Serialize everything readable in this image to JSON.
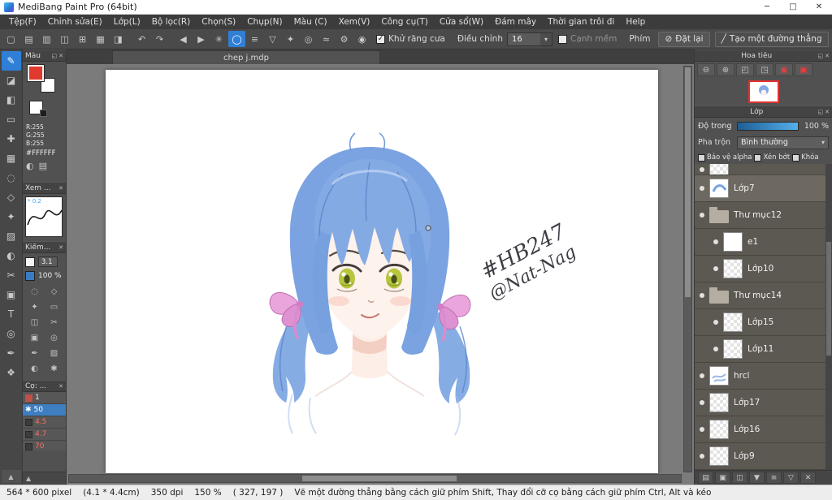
{
  "window": {
    "title": "MediBang Paint Pro (64bit)",
    "minimize": "─",
    "maximize": "□",
    "close": "✕"
  },
  "menu": {
    "items": [
      "Tệp(F)",
      "Chỉnh sửa(E)",
      "Lớp(L)",
      "Bộ lọc(R)",
      "Chọn(S)",
      "Chụp(N)",
      "Màu (C)",
      "Xem(V)",
      "Công cụ(T)",
      "Cửa sổ(W)",
      "Đám mây",
      "Thời gian trôi đi",
      "Help"
    ]
  },
  "toolbar": {
    "icons": [
      "▢",
      "▤",
      "▥",
      "◫",
      "⊞",
      "▦",
      "◨",
      "↶",
      "↷",
      "◀",
      "▶",
      "✳",
      "◯",
      "≡",
      "▽",
      "✦",
      "◎",
      "≈",
      "⚙",
      "◉"
    ],
    "check_mark": "✓",
    "antialias_label": "Khử răng cưa",
    "adjust_label": "Điều chỉnh",
    "adjust_value": "16",
    "dropdown_arrow": "▾",
    "soft_edge_label": "Cạnh mềm",
    "key_label": "Phím",
    "reset_icon": "⊘",
    "reset_label": "Đặt lại",
    "line_icon": "╱",
    "line_label": "Tạo một đường thẳng"
  },
  "tools": {
    "icons": [
      "✎",
      "◪",
      "◧",
      "▭",
      "✚",
      "▦",
      "◌",
      "◇",
      "✦",
      "▨",
      "◐",
      "✂",
      "▣",
      "T",
      "◎",
      "✒",
      "❖"
    ]
  },
  "panel_chrome": {
    "float_icon": "◱",
    "close_icon": "✕",
    "collapse_icon": "▲"
  },
  "color_panel": {
    "title": "Màu",
    "r": "R:255",
    "g": "G:255",
    "b": "B:255",
    "hex": "#FFFFFF",
    "icons": [
      "◐",
      "▤"
    ]
  },
  "preview_panel": {
    "title": "Xem ...",
    "value": "* 0.2"
  },
  "control_panel": {
    "title": "Kiểm...",
    "size_value": "3.1",
    "opacity_value": "100 %",
    "grid_icons": [
      "◌",
      "◇",
      "✦",
      "▭",
      "◫",
      "✂",
      "▣",
      "◎",
      "✒",
      "▨",
      "◐",
      "✱"
    ]
  },
  "brush_panel": {
    "title": "Cọ: ...",
    "star_icon": "✱",
    "items": [
      {
        "label": "1"
      },
      {
        "label": "50"
      },
      {
        "label": "4.5"
      },
      {
        "label": "4.7"
      },
      {
        "label": "70"
      }
    ]
  },
  "canvas": {
    "tab": "chep j.mdp",
    "signature_line1": "#HB247",
    "signature_line2": "@Nat-Nag"
  },
  "navigator": {
    "title": "Hoa tiêu",
    "icons": [
      "⊖",
      "⊕",
      "◰",
      "◳",
      "▣",
      "▣"
    ]
  },
  "layers": {
    "title": "Lớp",
    "opacity_label": "Độ trong",
    "opacity_value": "100 %",
    "blend_label": "Pha trộn",
    "blend_value": "Bình thường",
    "dropdown_arrow": "▾",
    "checkboxes": [
      "Bảo vệ alpha",
      "Xén bớt",
      "Khóa"
    ],
    "items": [
      {
        "name": "Lớp7"
      },
      {
        "name": "Thư mục12"
      },
      {
        "name": "e1"
      },
      {
        "name": "Lớp10"
      },
      {
        "name": "Thư mục14"
      },
      {
        "name": "Lớp15"
      },
      {
        "name": "Lớp11"
      },
      {
        "name": "hrcl"
      },
      {
        "name": "Lớp17"
      },
      {
        "name": "Lớp16"
      },
      {
        "name": "Lớp9"
      }
    ],
    "bottom_icons": [
      "▤",
      "▣",
      "◫",
      "▼",
      "≡",
      "▽",
      "✕"
    ]
  },
  "statusbar": {
    "size": "564 * 600 pixel",
    "dimensions": "(4.1 * 4.4cm)",
    "dpi": "350 dpi",
    "zoom": "150 %",
    "coords": "( 327, 197 )",
    "hint": "Vẽ một đường thẳng bằng cách giữ phím Shift, Thay đổi cỡ cọ bằng cách giữ phím Ctrl, Alt và kéo"
  }
}
